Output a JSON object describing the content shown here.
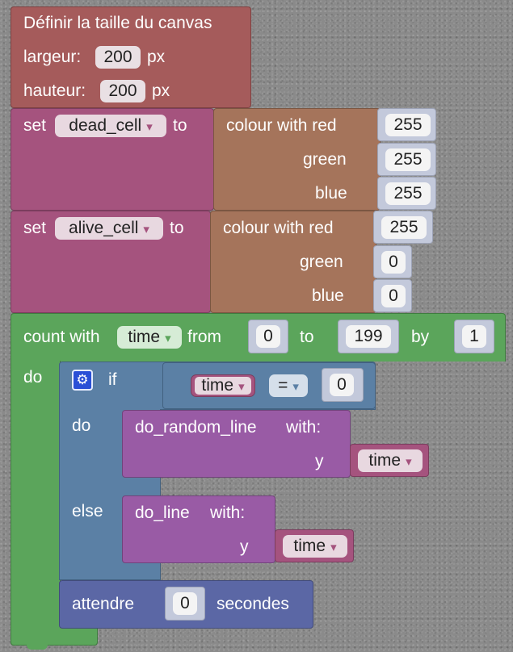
{
  "canvas_block": {
    "title": "Définir la taille du canvas",
    "width_label": "largeur:",
    "width_value": "200",
    "width_unit": "px",
    "height_label": "hauteur:",
    "height_value": "200",
    "height_unit": "px"
  },
  "set_dead": {
    "set_label": "set",
    "variable": "dead_cell",
    "to_label": "to",
    "colour_label": "colour with red",
    "red": "255",
    "green_label": "green",
    "green": "255",
    "blue_label": "blue",
    "blue": "255"
  },
  "set_alive": {
    "set_label": "set",
    "variable": "alive_cell",
    "to_label": "to",
    "colour_label": "colour with red",
    "red": "255",
    "green_label": "green",
    "green": "0",
    "blue_label": "blue",
    "blue": "0"
  },
  "loop": {
    "count_label": "count with",
    "variable": "time",
    "from_label": "from",
    "from_value": "0",
    "to_label": "to",
    "to_value": "199",
    "by_label": "by",
    "by_value": "1",
    "do_label": "do"
  },
  "if_block": {
    "if_label": "if",
    "var": "time",
    "operator": "=",
    "compare_value": "0",
    "do_label": "do",
    "else_label": "else"
  },
  "call_random": {
    "name": "do_random_line",
    "with_label": "with:",
    "param": "y",
    "arg": "time"
  },
  "call_line": {
    "name": "do_line",
    "with_label": "with:",
    "param": "y",
    "arg": "time"
  },
  "wait_block": {
    "label": "attendre",
    "value": "0",
    "unit": "secondes"
  },
  "dropdown_glyph": "▾",
  "colors": {
    "canvas": "#a55b5b",
    "variables": "#a5537e",
    "colour": "#a5745b",
    "number_block": "#c3c9db",
    "loop": "#5ba55b",
    "logic": "#5b80a5",
    "procedure": "#995ba5",
    "wait": "#5b67a5"
  }
}
